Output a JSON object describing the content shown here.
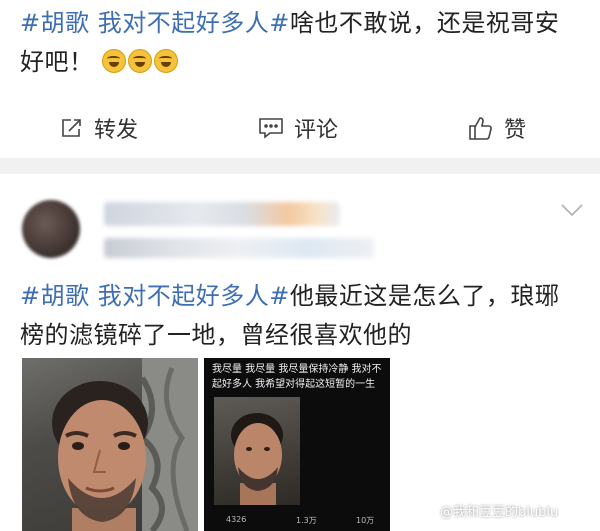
{
  "post1": {
    "hashtag1": "#胡歌",
    "hashtag2": "我对不起好多人#",
    "text_line1": "啥也不敢说，还是祝哥安",
    "text_line2": "好吧！",
    "emoji_name": "crying-laughing-emoji"
  },
  "actions": {
    "repost": "转发",
    "comment": "评论",
    "like": "赞"
  },
  "post2": {
    "hashtag1": "#胡歌",
    "hashtag2": "我对不起好多人#",
    "text_line1": "他最近这是怎么了，琅琊",
    "text_line2": "榜的滤镜碎了一地，曾经很喜欢他的",
    "image2": {
      "caption": "我尽量 我尽量 我尽量保持冷静 我对不起好多人 我希望对得起这短暂的一生",
      "likes": "4326",
      "comments": "1.3万",
      "reposts": "10万"
    }
  },
  "watermark": "@我和豆豆的blublu",
  "colors": {
    "hashtag": "#3e6fb2",
    "divider": "#f1f1f1"
  }
}
